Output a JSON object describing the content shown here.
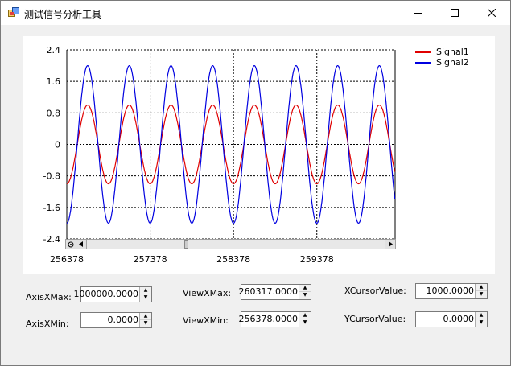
{
  "window": {
    "title": "测试信号分析工具"
  },
  "chart_data": {
    "type": "line",
    "title": "",
    "xlabel": "",
    "ylabel": "",
    "xlim": [
      256378,
      260317
    ],
    "ylim": [
      -2.4,
      2.4
    ],
    "y_ticks": [
      "2.4",
      "1.6",
      "0.8",
      "0",
      "-0.8",
      "-1.6",
      "-2.4"
    ],
    "x_ticks": [
      "256378",
      "257378",
      "258378",
      "259378"
    ],
    "series": [
      {
        "name": "Signal1",
        "color": "#e00000",
        "amplitude": 1.0,
        "period": 500,
        "phase_offset_at_xmin_deg": -90
      },
      {
        "name": "Signal2",
        "color": "#0000e0",
        "amplitude": 2.0,
        "period": 500,
        "phase_offset_at_xmin_deg": -90
      }
    ],
    "grid": true,
    "legend": "top-right"
  },
  "controls": {
    "axis_xmax": {
      "label": "AxisXMax:",
      "value": "1000000.0000"
    },
    "axis_xmin": {
      "label": "AxisXMin:",
      "value": "0.0000"
    },
    "view_xmax": {
      "label": "ViewXMax:",
      "value": "260317.0000"
    },
    "view_xmin": {
      "label": "ViewXMin:",
      "value": "256378.0000"
    },
    "x_cursor": {
      "label": "XCursorValue:",
      "value": "1000.0000"
    },
    "y_cursor": {
      "label": "YCursorValue:",
      "value": "0.0000"
    }
  }
}
